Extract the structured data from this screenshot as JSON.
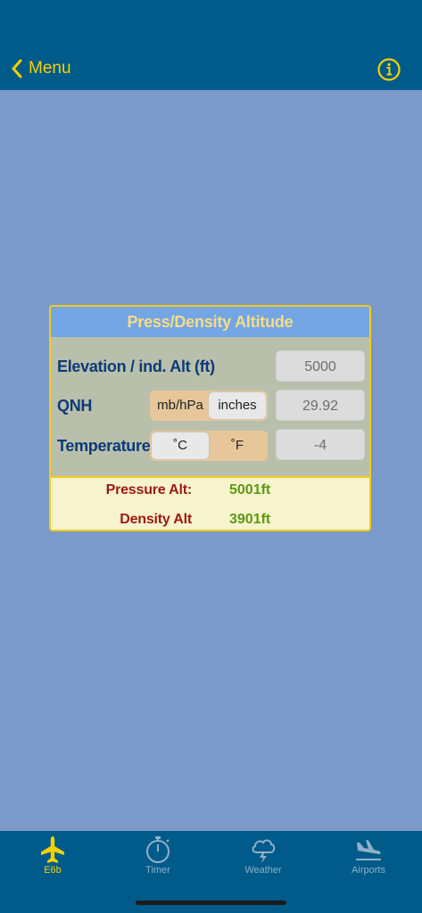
{
  "nav": {
    "back_label": "Menu"
  },
  "card": {
    "title": "Press/Density Altitude",
    "rows": {
      "elevation": {
        "label": "Elevation / ind. Alt (ft)",
        "value": "5000"
      },
      "qnh": {
        "label": "QNH",
        "units": [
          "mb/hPa",
          "inches"
        ],
        "selected_unit": "inches",
        "value": "29.92"
      },
      "temperature": {
        "label": "Temperature",
        "units": [
          "˚C",
          "˚F"
        ],
        "selected_unit": "˚C",
        "value": "-4"
      }
    },
    "results": {
      "pressure_alt": {
        "label": "Pressure Alt:",
        "value": "5001ft"
      },
      "density_alt": {
        "label": "Density Alt",
        "value": "3901ft"
      }
    }
  },
  "tabs": [
    {
      "label": "E6b",
      "icon": "airplane-icon",
      "active": true
    },
    {
      "label": "Timer",
      "icon": "stopwatch-icon",
      "active": false
    },
    {
      "label": "Weather",
      "icon": "thunderstorm-icon",
      "active": false
    },
    {
      "label": "Airports",
      "icon": "airplane-landing-icon",
      "active": false
    }
  ],
  "colors": {
    "accent": "#f5d000",
    "bar": "#005b8a",
    "background": "#7b9ac9",
    "label_blue": "#0f3a78",
    "result_red": "#9b1a12",
    "result_green": "#5a9a12"
  }
}
